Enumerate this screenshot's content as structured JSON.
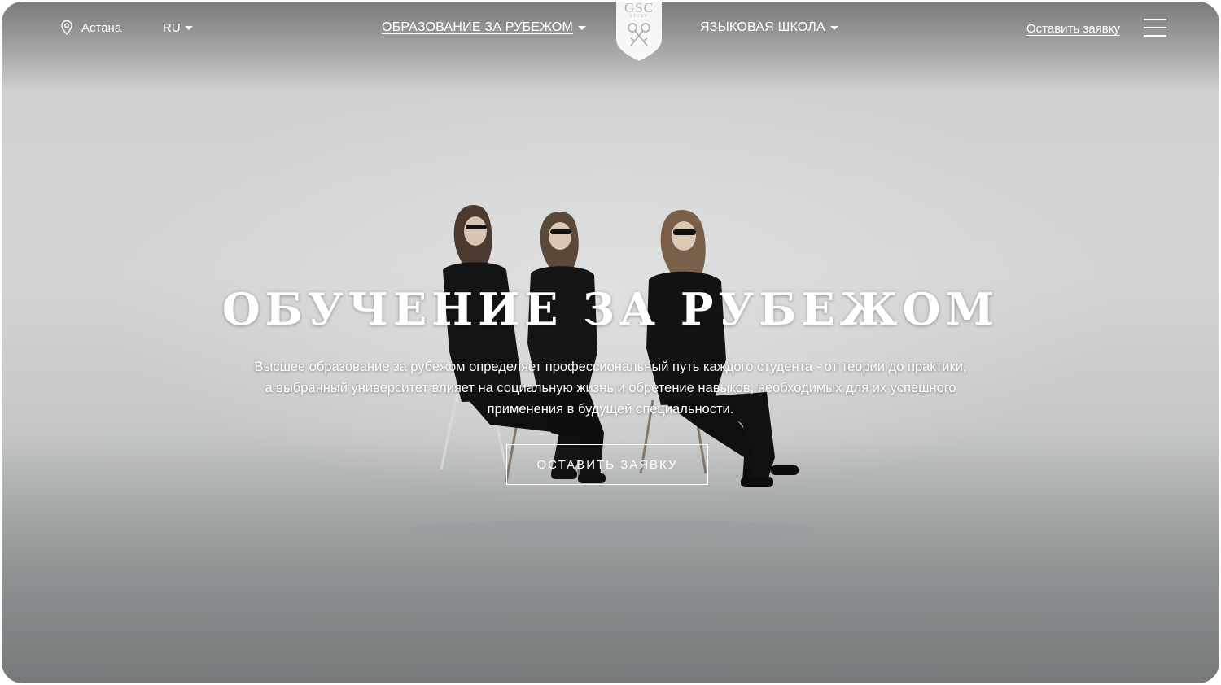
{
  "header": {
    "city": "Астана",
    "language": "RU",
    "nav": [
      {
        "label": "ОБРАЗОВАНИЕ ЗА РУБЕЖОМ"
      },
      {
        "label": "ЯЗЫКОВАЯ ШКОЛА"
      }
    ],
    "logo": {
      "text": "GSC",
      "subtext": "STUDY"
    },
    "cta_label": "Оставить заявку"
  },
  "hero": {
    "title": "ОБУЧЕНИЕ ЗА РУБЕЖОМ",
    "description_line1": "Высшее образование за рубежом определяет профессиональный путь каждого студента - от теории до практики,",
    "description_line2": "а выбранный университет влияет на социальную жизнь и обретение навыков, необходимых для их успешного",
    "description_line3": "применения в будущей специальности.",
    "button_label": "ОСТАВИТЬ ЗАЯВКУ"
  },
  "icons": {
    "location": "map-pin-icon",
    "menu": "hamburger-menu-icon",
    "dropdown": "caret-down-icon"
  },
  "colors": {
    "text": "#ffffff",
    "background_light": "#d3d4d4",
    "background_dark": "#8a8d8e"
  }
}
